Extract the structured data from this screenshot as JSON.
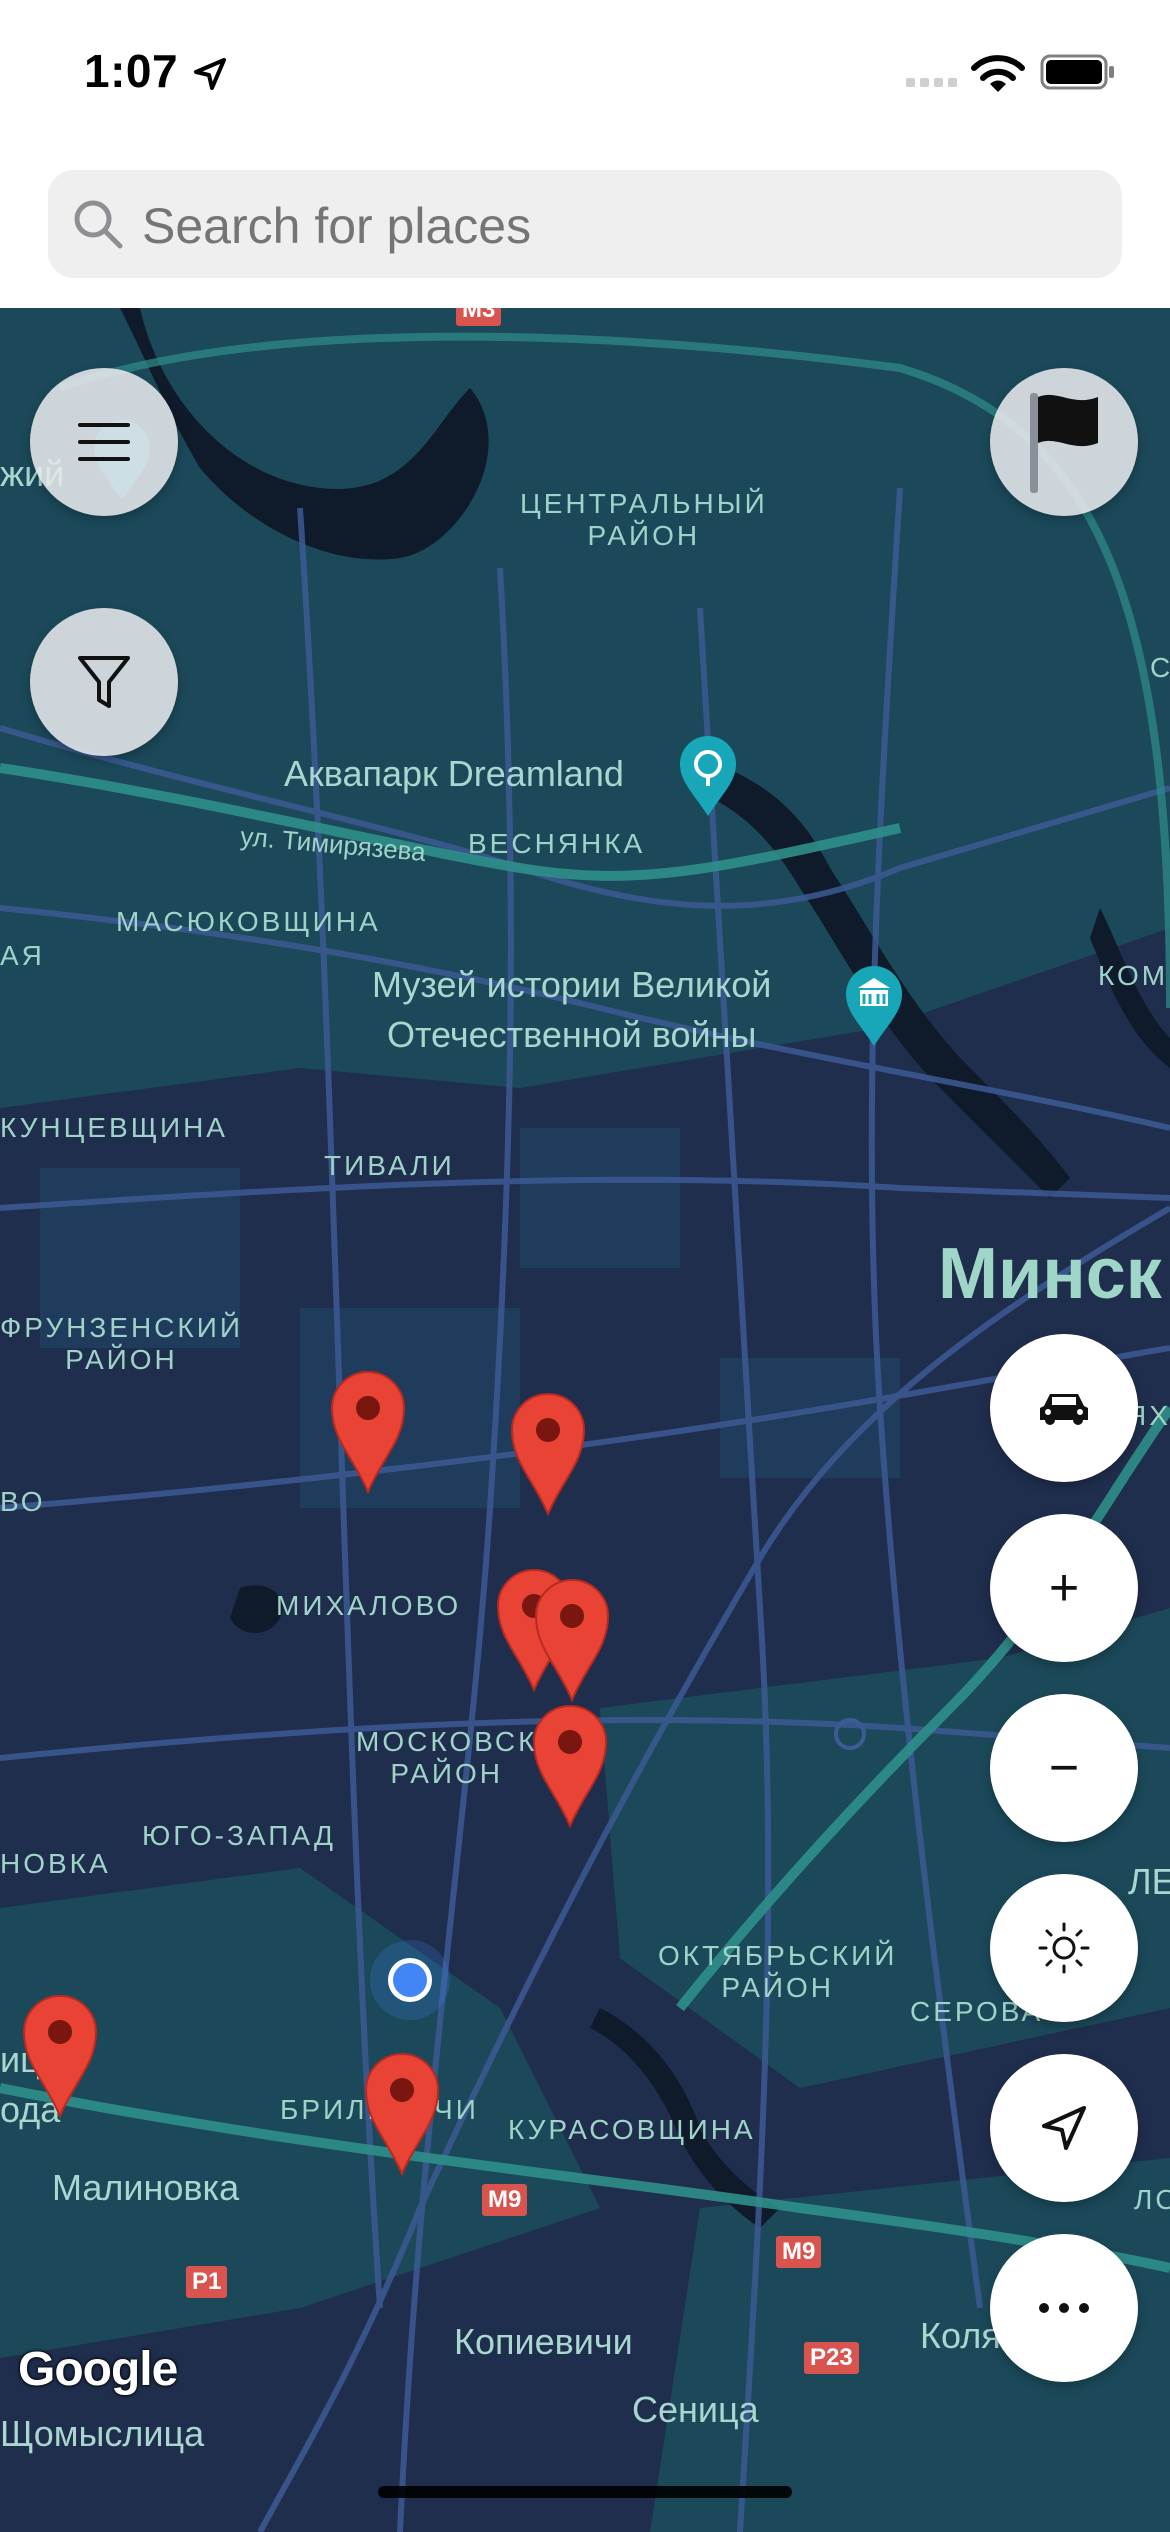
{
  "status_bar": {
    "time": "1:07"
  },
  "search": {
    "placeholder": "Search for places"
  },
  "map": {
    "districts": {
      "central": "ЦЕНТРАЛЬНЫЙ\nРАЙОН",
      "vesnyanka": "ВЕСНЯНКА",
      "masyukovshchina": "МАСЮКОВЩИНА",
      "kuntsevshchina": "КУНЦЕВЩИНА",
      "tivali": "ТИВАЛИ",
      "frunzensky": "ФРУНЗЕНСКИЙ\nРАЙОН",
      "mikhalovo": "МИХАЛОВО",
      "moskovsky": "МОСКОВСК\nРАЙОН",
      "yugo_zapad": "ЮГО-ЗАПАД",
      "oktyabrsky": "ОКТЯБРЬСКИЙ\nРАЙОН",
      "serova": "СЕРОВА",
      "brilevichi": "БРИЛЕВИЧИ",
      "kurasovshchina": "КУРАСОВЩИНА",
      "kom": "КОМ",
      "novka": "НОВКА",
      "vo": "ВО",
      "aya": "АЯ",
      "zhiy": "жий",
      "yakh": "ЯХ",
      "le": "ЛЕ",
      "lo": "ЛО",
      "c": "С"
    },
    "places": {
      "aquapark": "Аквапарк Dreamland",
      "museum": "Музей истории Великой\nОтечественной войны",
      "street": "ул. Тимирязева",
      "city": "Минск",
      "malinovka": "Малиновка",
      "kopievichi": "Копиевичи",
      "senitsa": "Сеница",
      "shchomyslitsa": "Щомыслица",
      "koly": "Коля",
      "tsy": "ицы",
      "oda": "ода"
    },
    "road_shields": [
      "M9",
      "M9",
      "P1",
      "P23",
      "M3"
    ],
    "attribution": "Google"
  },
  "controls": {
    "menu_icon": "hamburger-icon",
    "filter_icon": "funnel-icon",
    "flag_icon": "flag-icon",
    "car_icon": "car-icon",
    "zoom_in": "+",
    "zoom_out": "−",
    "brightness_icon": "sun-icon",
    "locate_icon": "navigation-arrow-icon",
    "more_icon": "ellipsis-icon"
  },
  "colors": {
    "map_bg": "#1f2e4d",
    "pin": "#e84335",
    "user_dot": "#4285f4"
  }
}
